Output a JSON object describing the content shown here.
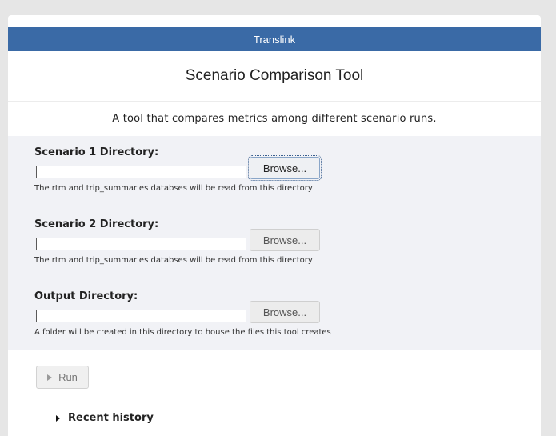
{
  "header": {
    "title": "Translink"
  },
  "page": {
    "title": "Scenario Comparison Tool",
    "subtitle": "A tool that compares metrics among different scenario runs."
  },
  "form": {
    "fields": [
      {
        "label": "Scenario 1 Directory:",
        "value": "",
        "browse_label": "Browse...",
        "help": "The rtm and trip_summaries databses will be read from this directory"
      },
      {
        "label": "Scenario 2 Directory:",
        "value": "",
        "browse_label": "Browse...",
        "help": "The rtm and trip_summaries databses will be read from this directory"
      },
      {
        "label": "Output Directory:",
        "value": "",
        "browse_label": "Browse...",
        "help": "A folder will be created in this directory to house the files this tool creates"
      }
    ]
  },
  "actions": {
    "run_label": "Run",
    "run_icon": "play-icon"
  },
  "history": {
    "label": "Recent history",
    "icon": "caret-right-icon"
  },
  "colors": {
    "header_bg": "#3a6aa6",
    "panel_bg": "#f1f2f6",
    "page_bg": "#e6e6e6"
  }
}
